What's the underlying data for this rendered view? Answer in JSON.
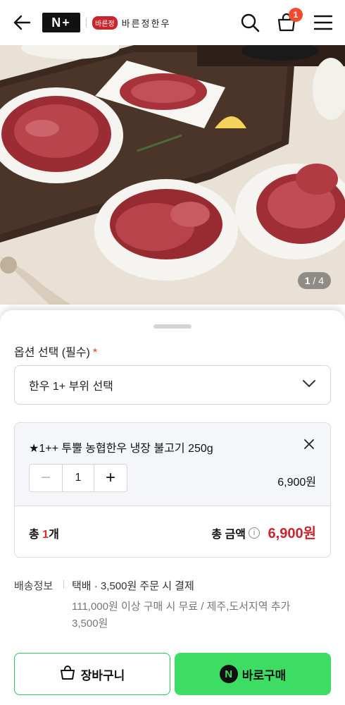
{
  "header": {
    "logo_text": "N+",
    "store_badge": "바른정",
    "store_name": "바른정한우",
    "cart_count": "1",
    "icons": [
      "back-arrow-icon",
      "search-icon",
      "cart-icon",
      "menu-icon"
    ]
  },
  "hero": {
    "counter_current": "1",
    "counter_total": "/ 4"
  },
  "options": {
    "title": "옵션 선택 (필수)",
    "required_mark": "*",
    "select_value": "한우 1+ 부위 선택"
  },
  "selected_item": {
    "name": "★1++ 투뿔 농협한우 냉장 불고기 250g",
    "quantity": "1",
    "price": "6,900원",
    "minus": "−",
    "plus": "+"
  },
  "totals": {
    "count_prefix": "총 ",
    "count_value": "1",
    "count_suffix": "개",
    "amount_label": "총 금액",
    "amount_value": "6,900원",
    "info_glyph": "i"
  },
  "shipping": {
    "label": "배송정보",
    "main": "택배 · 3,500원 주문 시 결제",
    "sub": "111,000원 이상 구매 시 무료 / 제주,도서지역 추가 3,500원"
  },
  "actions": {
    "cart_label": "장바구니",
    "buy_label": "바로구매",
    "npay_glyph": "N"
  },
  "colors": {
    "accent_red": "#c8262c",
    "buy_green": "#3ddc63",
    "badge_orange": "#f04b2c"
  }
}
